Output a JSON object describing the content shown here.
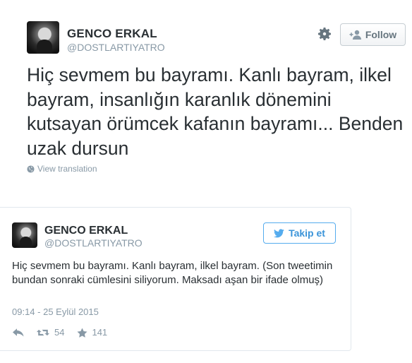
{
  "main_tweet": {
    "author_name": "GENCO ERKAL",
    "author_handle": "@DOSTLARTIYATRO",
    "follow_label": "Follow",
    "text": "Hiç sevmem bu bayramı. Kanlı bayram, ilkel bayram, insanlığın karanlık dönemini kutsayan örümcek kafanın bayramı... Benden uzak dursun",
    "view_translation": "View translation",
    "avatar_icon": "profile-photo",
    "settings_icon": "gear-icon",
    "globe_icon": "globe-icon"
  },
  "embedded_tweet": {
    "author_name": "GENCO ERKAL",
    "author_handle": "@DOSTLARTIYATRO",
    "follow_label": "Takip et",
    "text": "Hiç sevmem bu bayramı. Kanlı bayram, ilkel bayram. (Son tweetimin bundan sonraki cümlesini siliyorum. Maksadı aşan bir ifade olmuş)",
    "timestamp": "09:14 - 25 Eylül 2015",
    "retweet_count": "54",
    "like_count": "141",
    "colors": {
      "accent": "#55acee",
      "muted": "#8899a6",
      "text": "#292f33"
    }
  }
}
